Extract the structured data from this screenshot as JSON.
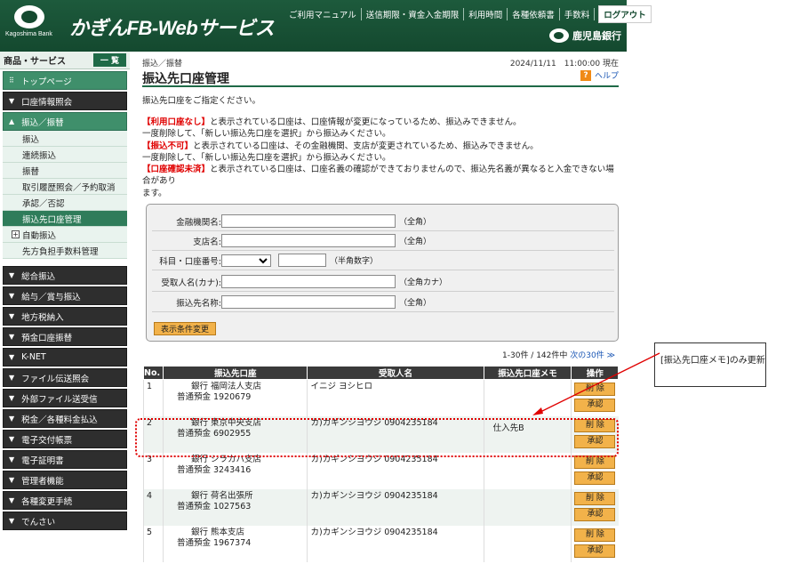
{
  "header": {
    "logo_text": "Kagoshima Bank",
    "app_title": "かぎんFB-Webサービス",
    "topnav": [
      "ご利用マニュアル",
      "送信期限・資金入金期限",
      "利用時間",
      "各種依頼書",
      "手数料"
    ],
    "logout_label": "ログアウト",
    "bank_name": "鹿児島銀行"
  },
  "sidebar": {
    "title": "商品・サービス",
    "list_button": "一 覧",
    "top_page": "トップページ",
    "sections_before": [
      "口座情報照会"
    ],
    "open_section": "振込／振替",
    "sub_items": [
      {
        "label": "振込",
        "active": false
      },
      {
        "label": "連続振込",
        "active": false
      },
      {
        "label": "振替",
        "active": false
      },
      {
        "label": "取引履歴照会／予約取消",
        "active": false
      },
      {
        "label": "承認／否認",
        "active": false
      },
      {
        "label": "振込先口座管理",
        "active": true
      }
    ],
    "sub_expand": "自動振込",
    "sub_last": "先方負担手数料管理",
    "sections_after": [
      "総合振込",
      "給与／賞与振込",
      "地方税納入",
      "預金口座振替",
      "K-NET",
      "ファイル伝送照会",
      "外部ファイル送受信",
      "税金／各種料金払込",
      "電子交付帳票",
      "電子証明書",
      "管理者機能",
      "各種変更手続",
      "でんさい"
    ]
  },
  "main": {
    "breadcrumb": "振込／振替",
    "datetime": "2024/11/11　11:00:00 現在",
    "title": "振込先口座管理",
    "help": "ヘルプ",
    "intro": "振込先口座をご指定ください。",
    "notes": [
      {
        "red": "【利用口座なし】",
        "text": "と表示されている口座は、口座情報が変更になっているため、振込みできません。"
      },
      {
        "red": "",
        "text": "一度削除して、「新しい振込先口座を選択」から振込みください。"
      },
      {
        "red": "【振込不可】",
        "text": "と表示されている口座は、その金融機関、支店が変更されているため、振込みできません。"
      },
      {
        "red": "",
        "text": "一度削除して、「新しい振込先口座を選択」から振込みください。"
      },
      {
        "red": "【口座確認未済】",
        "text": "と表示されている口座は、口座名義の確認ができておりませんので、振込先名義が異なると入金できない場合があり"
      },
      {
        "red": "",
        "text": "ます。"
      }
    ],
    "form": {
      "bank_label": "金融機関名:",
      "bank_hint": "（全角）",
      "branch_label": "支店名:",
      "branch_hint": "（全角）",
      "acct_label": "科目・口座番号:",
      "acct_hint": "（半角数字）",
      "payee_label": "受取人名(カナ):",
      "payee_hint": "（全角カナ）",
      "dest_label": "振込先名称:",
      "dest_hint": "（全角）",
      "submit": "表示条件変更"
    },
    "pager": {
      "range": "1-30件 / 142件中",
      "next": "次の30件 ≫"
    },
    "table": {
      "headers": [
        "No.",
        "振込先口座",
        "受取人名",
        "振込先口座メモ",
        "操作"
      ],
      "delete_label": "削 除",
      "approve_label": "承認",
      "rows": [
        {
          "no": "1",
          "acct1": "銀行 福岡法人支店",
          "acct2": "普通預金 1920679",
          "payee": "イニジ ヨシヒロ",
          "memo": ""
        },
        {
          "no": "2",
          "acct1": "銀行 東京中央支店",
          "acct2": "普通預金 6902955",
          "payee": "カ)カギンシヨウジ 0904235184",
          "memo": "仕入先B"
        },
        {
          "no": "3",
          "acct1": "銀行 シラカハ支店",
          "acct2": "普通預金 3243416",
          "payee": "カ)カギンシヨウジ 0904235184",
          "memo": ""
        },
        {
          "no": "4",
          "acct1": "銀行 荷名出張所",
          "acct2": "普通預金 1027563",
          "payee": "カ)カギンシヨウジ 0904235184",
          "memo": ""
        },
        {
          "no": "5",
          "acct1": "銀行 熊本支店",
          "acct2": "普通預金 1967374",
          "payee": "カ)カギンシヨウジ 0904235184",
          "memo": ""
        }
      ]
    }
  },
  "annotation": {
    "callout": "[振込先口座メモ]のみ更新"
  }
}
